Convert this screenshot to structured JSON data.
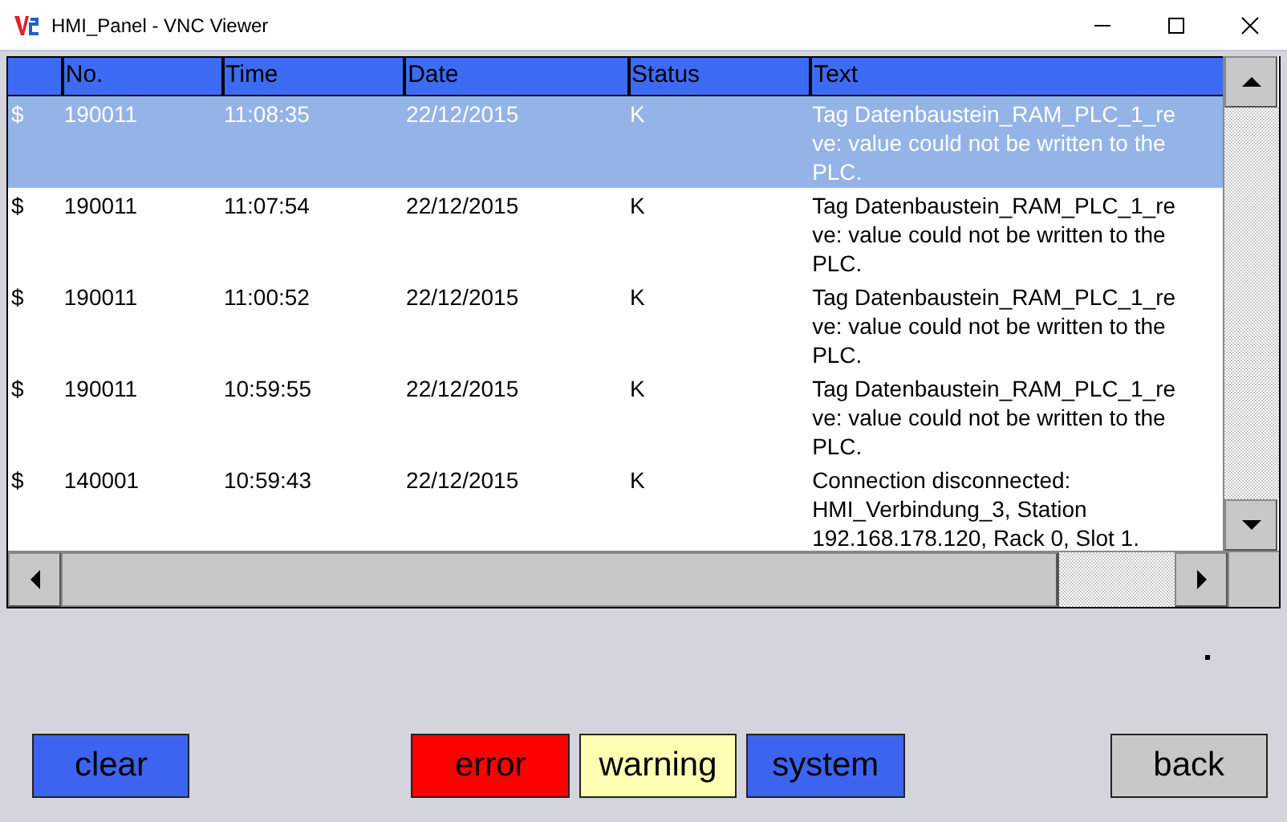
{
  "window": {
    "title": "HMI_Panel - VNC Viewer"
  },
  "table": {
    "columns": [
      "",
      "No.",
      "Time",
      "Date",
      "Status",
      "Text"
    ],
    "rows": [
      {
        "selected": true,
        "cells": [
          "$",
          "190011",
          "11:08:35",
          "22/12/2015",
          "K",
          "Tag Datenbaustein_RAM_PLC_1_re\nve: value could not be written to the\nPLC."
        ]
      },
      {
        "selected": false,
        "cells": [
          "$",
          "190011",
          "11:07:54",
          "22/12/2015",
          "K",
          "Tag Datenbaustein_RAM_PLC_1_re\nve: value could not be written to the\nPLC."
        ]
      },
      {
        "selected": false,
        "cells": [
          "$",
          "190011",
          "11:00:52",
          "22/12/2015",
          "K",
          "Tag Datenbaustein_RAM_PLC_1_re\nve: value could not be written to the\nPLC."
        ]
      },
      {
        "selected": false,
        "cells": [
          "$",
          "190011",
          "10:59:55",
          "22/12/2015",
          "K",
          "Tag Datenbaustein_RAM_PLC_1_re\nve: value could not be written to the\nPLC."
        ]
      },
      {
        "selected": false,
        "cells": [
          "$",
          "140001",
          "10:59:43",
          "22/12/2015",
          "K",
          "Connection disconnected:\nHMI_Verbindung_3, Station\n192.168.178.120, Rack 0, Slot 1."
        ]
      }
    ]
  },
  "buttons": [
    {
      "label": "clear",
      "color": "#3c64f0"
    },
    {
      "label": "error",
      "color": "#ff0000"
    },
    {
      "label": "warning",
      "color": "#ffffb4"
    },
    {
      "label": "system",
      "color": "#3c64f0"
    },
    {
      "label": "back",
      "color": "#c8c8c8"
    }
  ]
}
